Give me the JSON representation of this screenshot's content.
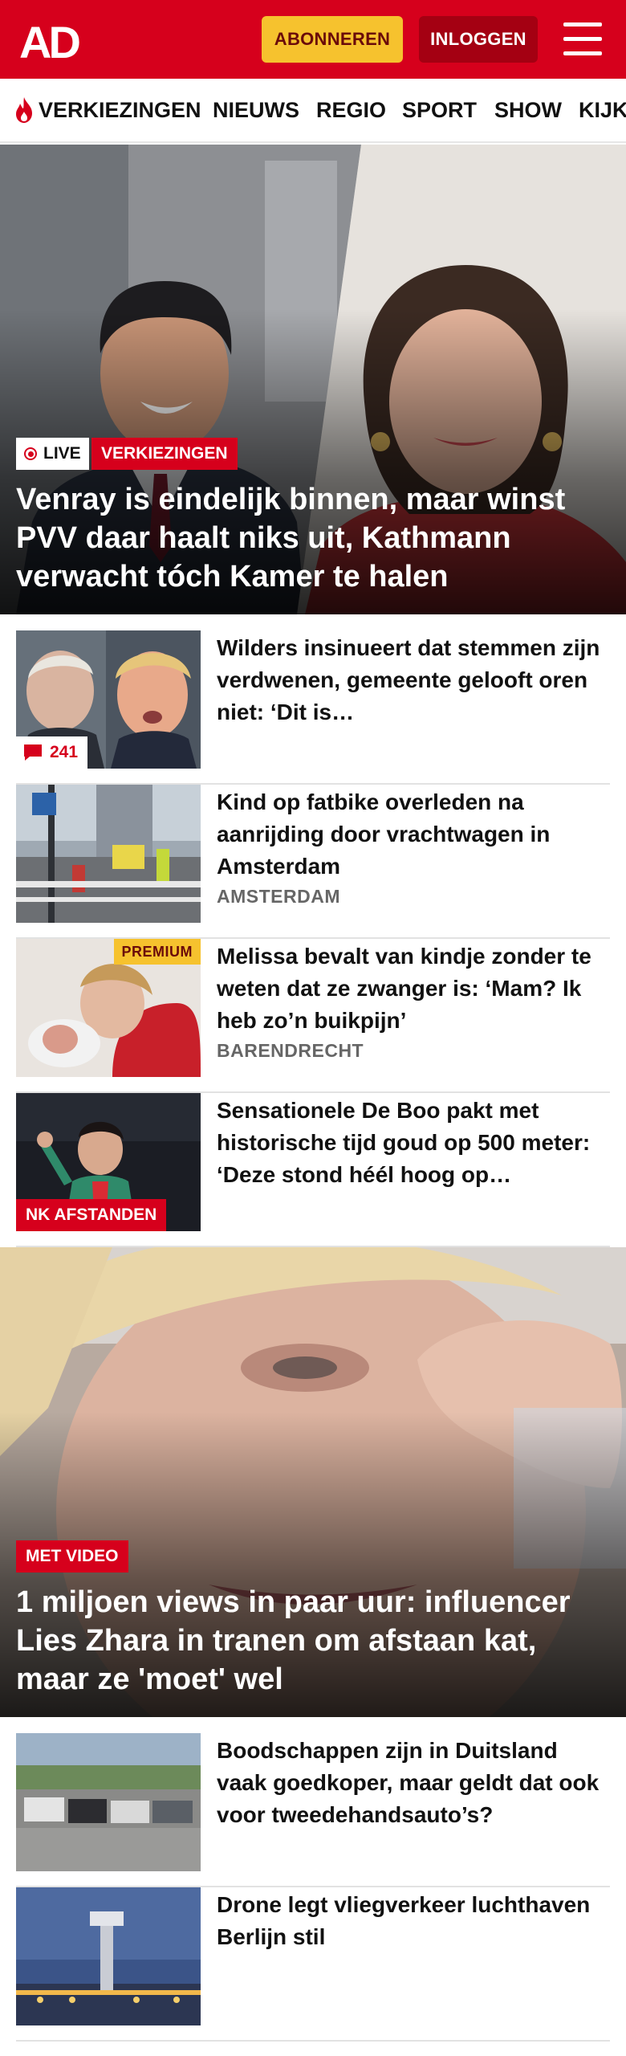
{
  "header": {
    "logo_text": "AD",
    "subscribe_label": "ABONNEREN",
    "login_label": "INLOGGEN",
    "menu_icon": "hamburger-menu-icon",
    "brand_color": "#d6001c"
  },
  "nav": {
    "items": [
      {
        "label": "VERKIEZINGEN",
        "icon": "flame-icon"
      },
      {
        "label": "NIEUWS"
      },
      {
        "label": "REGIO"
      },
      {
        "label": "SPORT"
      },
      {
        "label": "SHOW"
      },
      {
        "label": "KIJK"
      }
    ]
  },
  "hero1": {
    "live_label": "LIVE",
    "tag": "VERKIEZINGEN",
    "title": "Venray is eindelijk binnen, maar winst PVV daar haalt niks uit, Kathmann verwacht tóch Kamer te halen"
  },
  "articles": [
    {
      "title": "Wilders insinueert dat stemmen zijn verdwenen, gemeente gelooft oren niet: ‘Dit is…",
      "comments": "241"
    },
    {
      "title": "Kind op fatbike overleden na aanrijding door vrachtwagen in Amsterdam",
      "location": "AMSTERDAM"
    },
    {
      "title": "Melissa bevalt van kindje zonder te weten dat ze zwanger is: ‘Mam? Ik heb zo’n buikpijn’",
      "location": "BARENDRECHT",
      "badge": "PREMIUM"
    },
    {
      "title": "Sensationele De Boo pakt met historische tijd goud op 500 meter: ‘Deze stond héél hoog op…",
      "tag": "NK AFSTANDEN"
    }
  ],
  "hero2": {
    "tag": "MET VIDEO",
    "title": "1 miljoen views in paar uur: influencer Lies Zhara in tranen om afstaan kat, maar ze 'moet' wel"
  },
  "articles2": [
    {
      "title": "Boodschappen zijn in Duitsland vaak goedkoper, maar geldt dat ook voor tweedehandsauto’s?"
    },
    {
      "title": "Drone legt vliegverkeer luchthaven Berlijn stil"
    }
  ]
}
